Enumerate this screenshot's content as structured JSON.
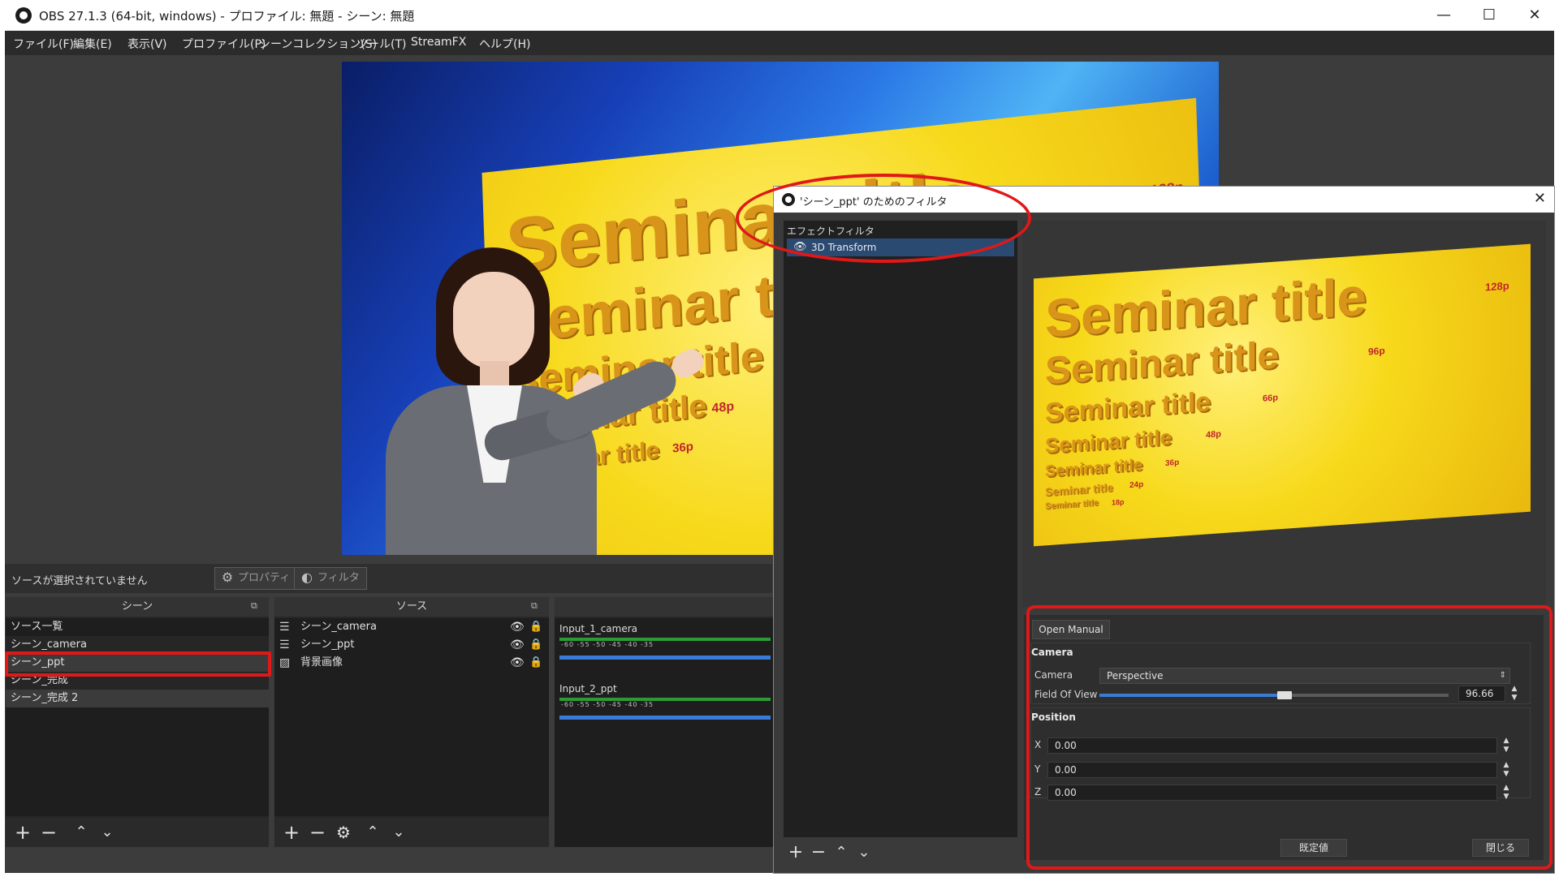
{
  "window": {
    "title": "OBS 27.1.3 (64-bit, windows) - プロファイル: 無題 - シーン: 無題",
    "minimize": "—",
    "maximize": "☐",
    "close": "✕"
  },
  "menu": [
    "ファイル(F)",
    "編集(E)",
    "表示(V)",
    "プロファイル(P)",
    "シーンコレクション(S)",
    "ツール(T)",
    "StreamFX",
    "ヘルプ(H)"
  ],
  "preview": {
    "slide_lines": [
      {
        "text": "Seminar title",
        "size_label": "128p"
      },
      {
        "text": "Seminar title",
        "size_label": "96p"
      },
      {
        "text": "Seminar title",
        "size_label": "66p"
      },
      {
        "text": "Seminar title",
        "size_label": "48p"
      },
      {
        "text": "Seminar title",
        "size_label": "36p"
      },
      {
        "text": "Seminar title",
        "size_label": "24p"
      },
      {
        "text": "Seminar title",
        "size_label": "18p"
      }
    ]
  },
  "source_toolbar": {
    "no_source": "ソースが選択されていません",
    "properties": "プロパティ",
    "filters": "フィルタ"
  },
  "scenes": {
    "header": "シーン",
    "items": [
      "ソース一覧",
      "シーン_camera",
      "シーン_ppt",
      "シーン_完成",
      "シーン_完成 2"
    ],
    "selected": "シーン_ppt"
  },
  "sources": {
    "header": "ソース",
    "items": [
      {
        "label": "シーン_camera",
        "icon": "list-icon"
      },
      {
        "label": "シーン_ppt",
        "icon": "list-icon"
      },
      {
        "label": "背景画像",
        "icon": "image-icon"
      }
    ]
  },
  "mixer": {
    "channels": [
      {
        "name": "Input_1_camera",
        "ticks": "-60  -55  -50  -45  -40  -35"
      },
      {
        "name": "Input_2_ppt",
        "ticks": "-60  -55  -50  -45  -40  -35"
      }
    ]
  },
  "dialog": {
    "title": "'シーン_ppt' のためのフィルタ",
    "effect_filters_label": "エフェクトフィルタ",
    "filters": [
      {
        "name": "3D Transform",
        "visible": true
      }
    ],
    "open_manual": "Open Manual",
    "camera_group": "Camera",
    "camera_label": "Camera",
    "camera_value": "Perspective",
    "fov_label": "Field Of View",
    "fov_value": "96.66",
    "fov_fraction": 0.53,
    "position_group": "Position",
    "pos": [
      {
        "axis": "X",
        "value": "0.00"
      },
      {
        "axis": "Y",
        "value": "0.00"
      },
      {
        "axis": "Z",
        "value": "0.00"
      }
    ],
    "defaults_button": "既定値",
    "close_button": "閉じる"
  },
  "colors": {
    "highlight": "#e01818",
    "accent": "#3a7bd5",
    "panel": "#272727"
  }
}
